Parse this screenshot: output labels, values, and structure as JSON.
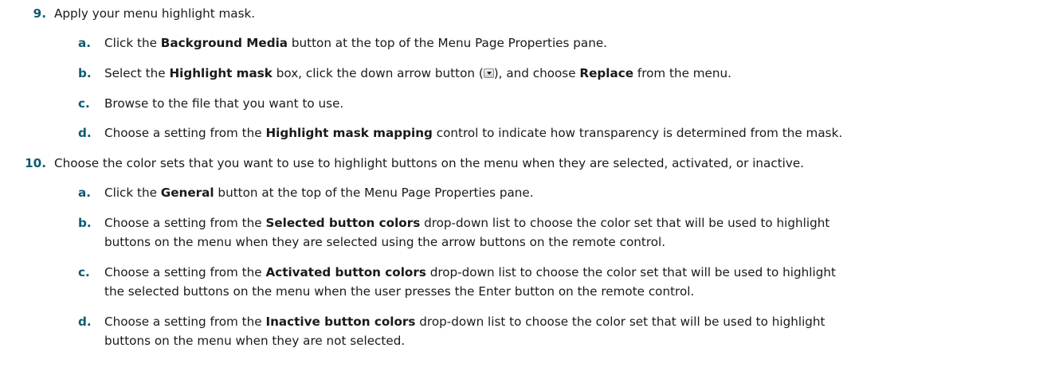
{
  "steps": [
    {
      "number": "9.",
      "text": "Apply your menu highlight mask.",
      "substeps": [
        {
          "letter": "a.",
          "parts": [
            "Click the ",
            "Background Media",
            " button at the top of the Menu Page Properties pane."
          ]
        },
        {
          "letter": "b.",
          "parts": [
            "Select the ",
            "Highlight mask",
            " box, click the down arrow button (",
            ") , and choose ",
            "Replace",
            " from the menu."
          ],
          "icon": "down-arrow-button-icon"
        },
        {
          "letter": "c.",
          "parts": [
            "Browse to the file that you want to use."
          ]
        },
        {
          "letter": "d.",
          "parts": [
            "Choose a setting from the ",
            "Highlight mask mapping",
            " control to indicate how transparency is determined from the mask."
          ]
        }
      ]
    },
    {
      "number": "10.",
      "text": "Choose the color sets that you want to use to highlight buttons on the menu when they are selected, activated, or inactive.",
      "substeps": [
        {
          "letter": "a.",
          "parts": [
            "Click the ",
            "General",
            " button at the top of the Menu Page Properties pane."
          ]
        },
        {
          "letter": "b.",
          "lines": [
            [
              "Choose a setting from the ",
              "Selected button colors",
              " drop-down list to choose the color set that will be used to highlight"
            ],
            [
              "buttons on the menu when they are selected using the arrow buttons on the remote control."
            ]
          ]
        },
        {
          "letter": "c.",
          "lines": [
            [
              "Choose a setting from the ",
              "Activated button colors",
              " drop-down list to choose the color set that will be used to highlight"
            ],
            [
              "the selected buttons on the menu when the user presses the Enter button on the remote control."
            ]
          ]
        },
        {
          "letter": "d.",
          "lines": [
            [
              "Choose a setting from the ",
              "Inactive button colors",
              " drop-down list to choose the color set that will be used to highlight"
            ],
            [
              "buttons on the menu when they are not selected."
            ]
          ]
        }
      ]
    }
  ]
}
